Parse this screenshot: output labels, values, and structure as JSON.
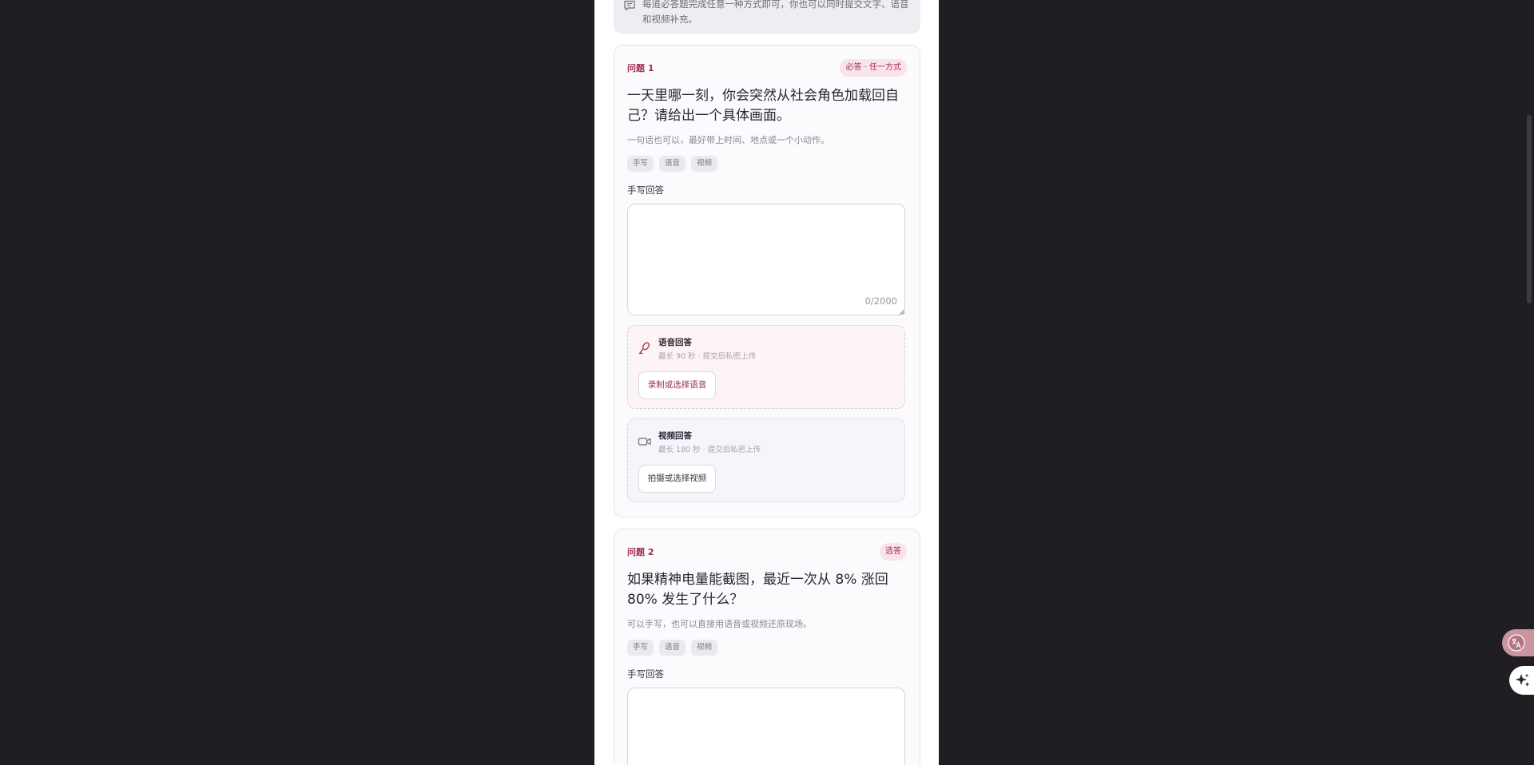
{
  "notice": {
    "text": "每道必答题完成任意一种方式即可，你也可以同时提交文字、语音和视频补充。"
  },
  "questions": [
    {
      "label": "问题 1",
      "badge": "必答 · 任一方式",
      "title": "一天里哪一刻，你会突然从社会角色加载回自己？请给出一个具体画面。",
      "hint": "一句话也可以，最好带上时间、地点或一个小动作。",
      "chips": [
        "手写",
        "语音",
        "视频"
      ],
      "text_section_label": "手写回答",
      "text_value": "",
      "counter": "0/2000",
      "voice": {
        "title": "语音回答",
        "subtitle": "最长 90 秒 · 提交后私密上传",
        "button": "录制或选择语音"
      },
      "video": {
        "title": "视频回答",
        "subtitle": "最长 180 秒 · 提交后私密上传",
        "button": "拍摄或选择视频"
      }
    },
    {
      "label": "问题 2",
      "badge": "选答",
      "title": "如果精神电量能截图，最近一次从 8% 涨回 80% 发生了什么？",
      "hint": "可以手写，也可以直接用语音或视频还原现场。",
      "chips": [
        "手写",
        "语音",
        "视频"
      ],
      "text_section_label": "手写回答",
      "text_value": ""
    }
  ],
  "icons": {
    "notice": "chat-bubble-icon",
    "voice": "microphone-icon",
    "video": "video-camera-icon",
    "translate": "translate-icon",
    "ai": "sparkle-icon"
  },
  "colors": {
    "accent": "#a12d4e",
    "page_background": "#201e23",
    "card_background": "#fbfafc"
  }
}
